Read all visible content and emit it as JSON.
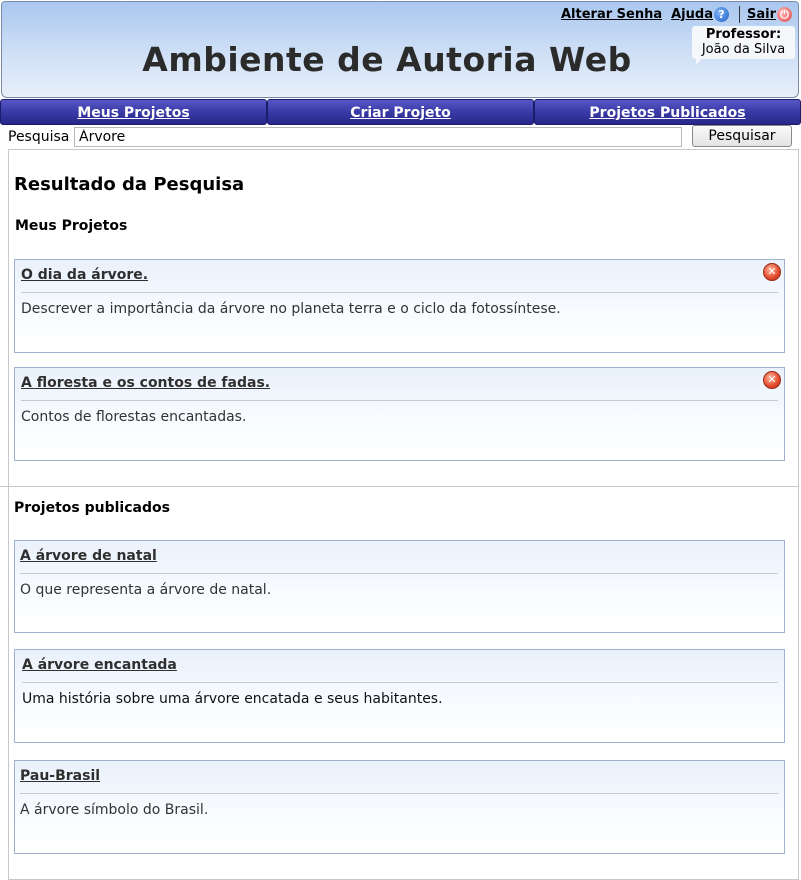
{
  "header": {
    "title": "Ambiente de Autoria Web",
    "links": {
      "change_password": "Alterar Senha",
      "help": "Ajuda",
      "logout": "Sair"
    },
    "user": {
      "role": "Professor:",
      "name": "João da Silva"
    }
  },
  "nav": {
    "tabs": [
      {
        "label": "Meus Projetos"
      },
      {
        "label": "Criar Projeto"
      },
      {
        "label": "Projetos Publicados"
      }
    ]
  },
  "search": {
    "label": "Pesquisa",
    "value": "Árvore",
    "button": "Pesquisar"
  },
  "results": {
    "title": "Resultado da Pesquisa",
    "my_projects": {
      "heading": "Meus Projetos",
      "items": [
        {
          "title": "O dia da árvore.",
          "description": "Descrever a importância da árvore no planeta terra e o ciclo da fotossíntese."
        },
        {
          "title": "A floresta e os contos de fadas.",
          "description": "Contos de florestas encantadas."
        }
      ]
    },
    "published": {
      "heading": "Projetos publicados",
      "items": [
        {
          "title": "A árvore de natal",
          "description": "O que representa a árvore de natal."
        },
        {
          "title": "A árvore encantada",
          "description": "Uma história sobre uma árvore encatada e seus habitantes."
        },
        {
          "title": "Pau-Brasil",
          "description": "A árvore símbolo do Brasil."
        }
      ]
    }
  },
  "icons": {
    "help": "help-icon",
    "logout": "power-icon",
    "delete": "delete-icon"
  }
}
